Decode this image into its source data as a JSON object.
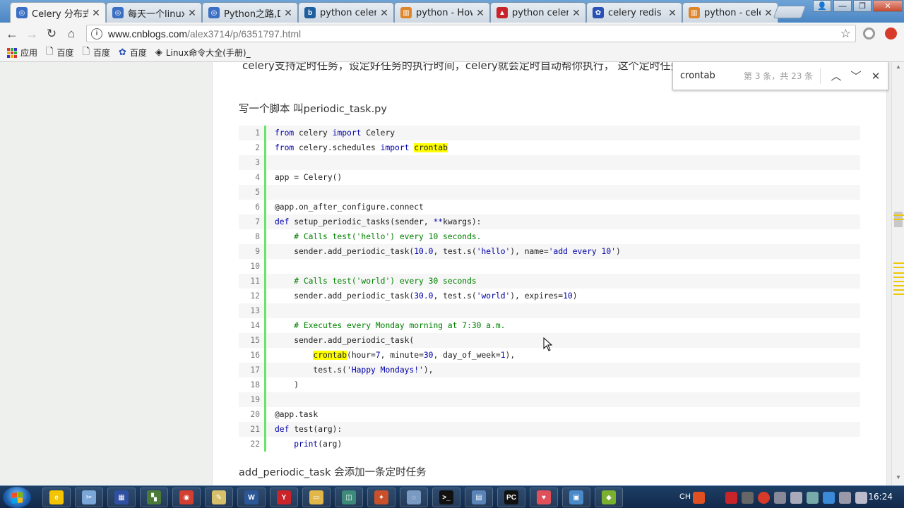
{
  "tabs": [
    {
      "title": "Celery 分布式",
      "color": "#3b6fc4",
      "glyph": "◎",
      "active": true
    },
    {
      "title": "每天一个linux",
      "color": "#3b6fc4",
      "glyph": "◎",
      "active": false
    },
    {
      "title": "Python之路,D",
      "color": "#3b6fc4",
      "glyph": "◎",
      "active": false
    },
    {
      "title": "python celer",
      "color": "#1f5fa0",
      "glyph": "b",
      "active": false
    },
    {
      "title": "python - How",
      "color": "#e0852a",
      "glyph": "▥",
      "active": false
    },
    {
      "title": "python celer",
      "color": "#c9242a",
      "glyph": "▲",
      "active": false
    },
    {
      "title": "celery redis p",
      "color": "#2a50b5",
      "glyph": "✿",
      "active": false
    },
    {
      "title": "python - cele",
      "color": "#e0852a",
      "glyph": "▥",
      "active": false
    }
  ],
  "address": {
    "host": "www.cnblogs.com",
    "path": "/alex3714/p/6351797.html"
  },
  "bookmarks": [
    {
      "label": "应用",
      "icon": "apps-icon"
    },
    {
      "label": "百度",
      "icon": "page-icon"
    },
    {
      "label": "百度",
      "icon": "page-icon"
    },
    {
      "label": "百度",
      "icon": "paw-icon"
    },
    {
      "label": "Linux命令大全(手册)_",
      "icon": "diamond-icon"
    }
  ],
  "article": {
    "cut_text": "celery支持定时任务，设定好任务的执行时间，celery就会定时自动帮你执行， 这个定时任务模块叫",
    "script_title": "写一个脚本 叫periodic_task.py",
    "after_code": "add_periodic_task 会添加一条定时任务"
  },
  "code_lines": [
    {
      "n": "1",
      "html": "<span class=\"kw\">from</span> celery <span class=\"kw\">import</span> Celery"
    },
    {
      "n": "2",
      "html": "<span class=\"kw\">from</span> celery.schedules <span class=\"kw\">import</span> <span class=\"hl\">crontab</span>"
    },
    {
      "n": "3",
      "html": ""
    },
    {
      "n": "4",
      "html": "app = Celery()"
    },
    {
      "n": "5",
      "html": ""
    },
    {
      "n": "6",
      "html": "@app.on_after_configure.connect"
    },
    {
      "n": "7",
      "html": "<span class=\"kw\">def</span> setup_periodic_tasks(sender, <span class=\"kw\">**</span>kwargs):"
    },
    {
      "n": "8",
      "html": "    <span class=\"cm\"># Calls test('hello') every 10 seconds.</span>"
    },
    {
      "n": "9",
      "html": "    sender.add_periodic_task(<span class=\"nm\">10.0</span>, test.s(<span class=\"st\">'hello'</span>), name=<span class=\"st\">'add every 10'</span>)"
    },
    {
      "n": "10",
      "html": ""
    },
    {
      "n": "11",
      "html": "    <span class=\"cm\"># Calls test('world') every 30 seconds</span>"
    },
    {
      "n": "12",
      "html": "    sender.add_periodic_task(<span class=\"nm\">30.0</span>, test.s(<span class=\"st\">'world'</span>), expires=<span class=\"nm\">10</span>)"
    },
    {
      "n": "13",
      "html": ""
    },
    {
      "n": "14",
      "html": "    <span class=\"cm\"># Executes every Monday morning at 7:30 a.m.</span>"
    },
    {
      "n": "15",
      "html": "    sender.add_periodic_task("
    },
    {
      "n": "16",
      "html": "        <span class=\"hl\">crontab</span>(hour=<span class=\"nm\">7</span>, minute=<span class=\"nm\">30</span>, day_of_week=<span class=\"nm\">1</span>),"
    },
    {
      "n": "17",
      "html": "        test.s(<span class=\"st\">'Happy Mondays!'</span>),"
    },
    {
      "n": "18",
      "html": "    )"
    },
    {
      "n": "19",
      "html": ""
    },
    {
      "n": "20",
      "html": "@app.task"
    },
    {
      "n": "21",
      "html": "<span class=\"kw\">def</span> test(arg):"
    },
    {
      "n": "22",
      "html": "    <span class=\"kw\">print</span>(arg)"
    }
  ],
  "find": {
    "query": "crontab",
    "count": "第 3 条，共 23 条"
  },
  "taskbar": {
    "lang": "CH",
    "time": "16:24",
    "items": [
      {
        "name": "ie-app",
        "color": "#f5c400",
        "glyph": "e"
      },
      {
        "name": "tool-app",
        "color": "#7aa7d8",
        "glyph": "✂"
      },
      {
        "name": "save-app",
        "color": "#2f4fa0",
        "glyph": "▦"
      },
      {
        "name": "puzzle-app",
        "color": "#4a7a3a",
        "glyph": "▚"
      },
      {
        "name": "chrome-app",
        "color": "#d23f31",
        "glyph": "◉"
      },
      {
        "name": "notepad-app",
        "color": "#d7c06a",
        "glyph": "✎"
      },
      {
        "name": "word-app",
        "color": "#2b5797",
        "glyph": "W"
      },
      {
        "name": "youdao-app",
        "color": "#c9242a",
        "glyph": "Y"
      },
      {
        "name": "folder-app",
        "color": "#e2b74a",
        "glyph": "▭"
      },
      {
        "name": "vm-app",
        "color": "#3d8a7a",
        "glyph": "◫"
      },
      {
        "name": "wing-app",
        "color": "#c9502a",
        "glyph": "✦"
      },
      {
        "name": "search-app",
        "color": "#7a9ac2",
        "glyph": "◌"
      },
      {
        "name": "cmd-app",
        "color": "#111111",
        "glyph": ">_"
      },
      {
        "name": "window-app",
        "color": "#5a84b8",
        "glyph": "▤"
      },
      {
        "name": "pycharm-app",
        "color": "#111111",
        "glyph": "PC"
      },
      {
        "name": "pocket-app",
        "color": "#e0505a",
        "glyph": "♥"
      },
      {
        "name": "remote-app",
        "color": "#4a8ac8",
        "glyph": "▣"
      },
      {
        "name": "green-app",
        "color": "#7ab030",
        "glyph": "◆"
      }
    ]
  }
}
